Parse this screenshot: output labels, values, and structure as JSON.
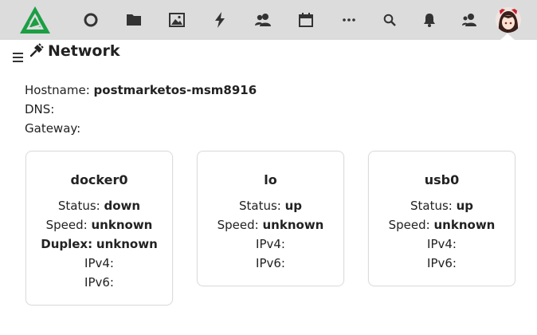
{
  "nav": {
    "icons": [
      "dashboard-icon",
      "files-icon",
      "photos-icon",
      "activity-icon",
      "contacts-icon",
      "calendar-icon",
      "more-apps-icon",
      "search-icon",
      "notifications-icon",
      "contacts-menu-icon"
    ],
    "brand_color": "#1b9e44",
    "bar_color": "#dcdcdc"
  },
  "page": {
    "title": "Network",
    "hostname_label": "Hostname:",
    "hostname_value": "postmarketos-msm8916",
    "dns_label": "DNS:",
    "gateway_label": "Gateway:"
  },
  "interfaces": [
    {
      "name": "docker0",
      "status_label": "Status:",
      "status_value": "down",
      "speed_label": "Speed:",
      "speed_value": "unknown",
      "duplex_label": "Duplex:",
      "duplex_value": "unknown",
      "ipv4_label": "IPv4:",
      "ipv6_label": "IPv6:"
    },
    {
      "name": "lo",
      "status_label": "Status:",
      "status_value": "up",
      "speed_label": "Speed:",
      "speed_value": "unknown",
      "ipv4_label": "IPv4:",
      "ipv6_label": "IPv6:"
    },
    {
      "name": "usb0",
      "status_label": "Status:",
      "status_value": "up",
      "speed_label": "Speed:",
      "speed_value": "unknown",
      "ipv4_label": "IPv4:",
      "ipv6_label": "IPv6:"
    }
  ]
}
